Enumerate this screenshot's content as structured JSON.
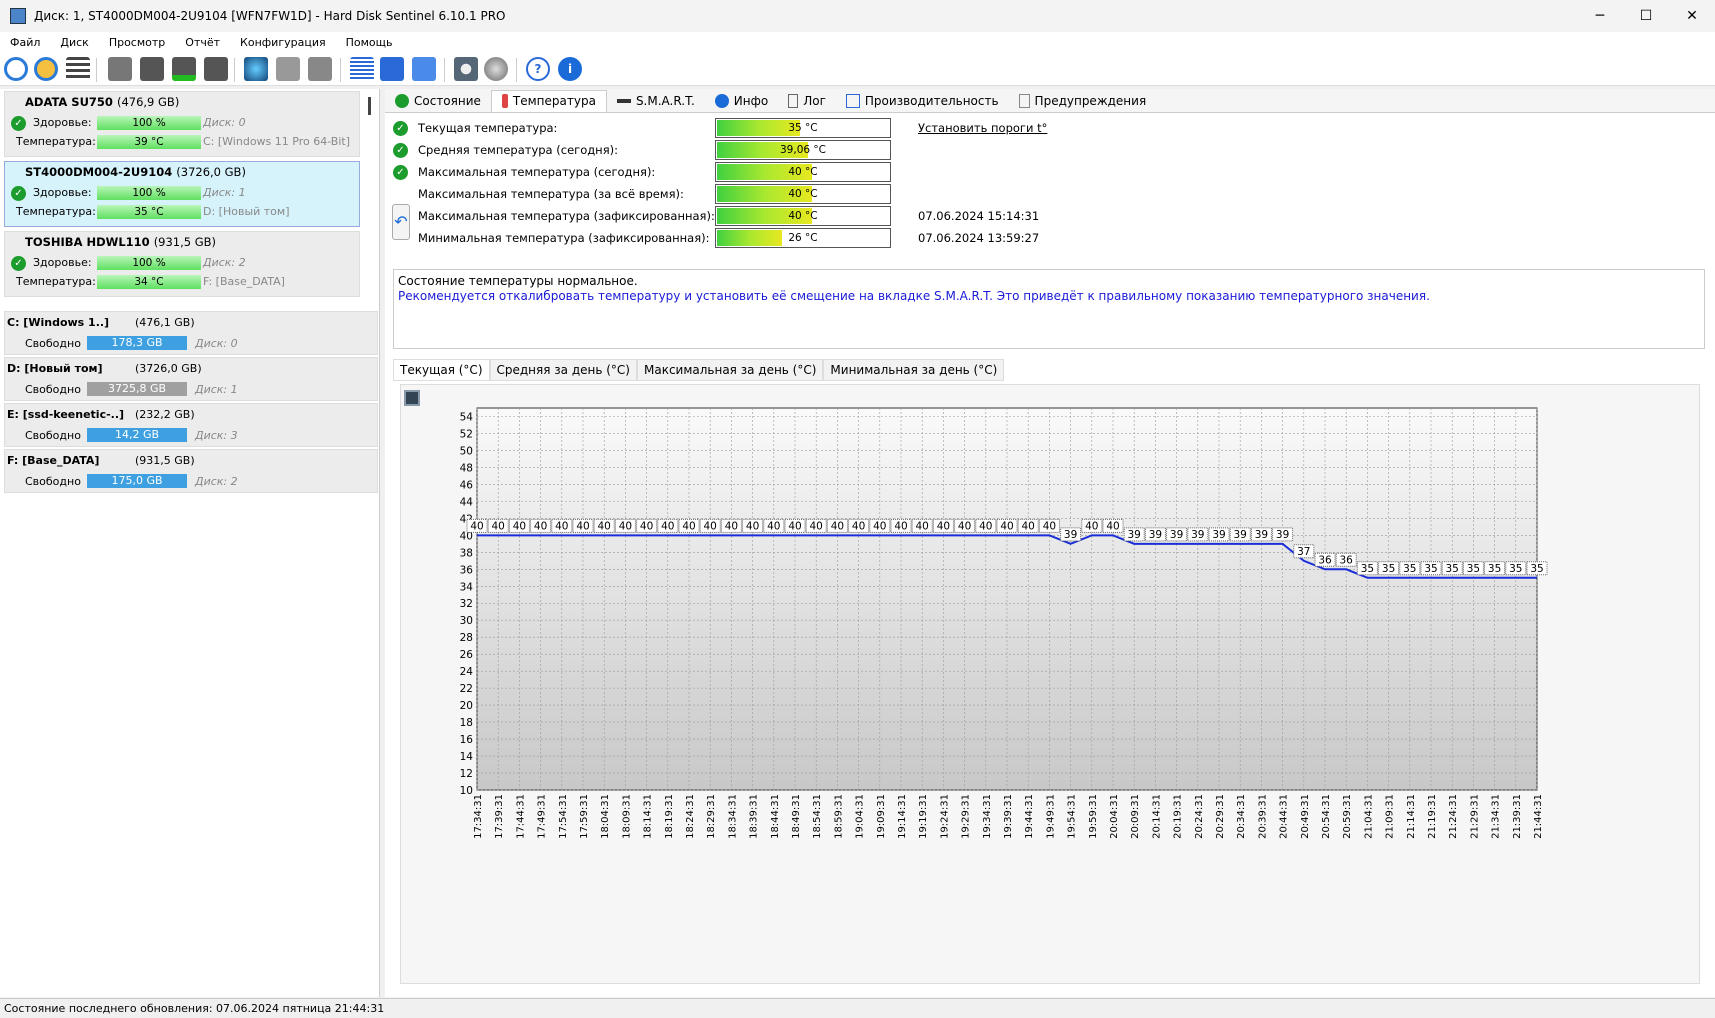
{
  "window": {
    "title": "Диск: 1, ST4000DM004-2U9104 [WFN7FW1D]  -  Hard Disk Sentinel 6.10.1 PRO",
    "min": "─",
    "max": "☐",
    "close": "✕"
  },
  "menu": [
    "Файл",
    "Диск",
    "Просмотр",
    "Отчёт",
    "Конфигурация",
    "Помощь"
  ],
  "disks": [
    {
      "name": "ADATA SU750",
      "size": "(476,9 GB)",
      "health_label": "Здоровье:",
      "health": "100 %",
      "health_value": 100,
      "disk": "Диск: 0",
      "temp_label": "Температура:",
      "temp": "39 °C",
      "vol": "C: [Windows 11 Pro 64-Bit]"
    },
    {
      "name": "ST4000DM004-2U9104",
      "size": "(3726,0 GB)",
      "health_label": "Здоровье:",
      "health": "100 %",
      "health_value": 100,
      "disk": "Диск: 1",
      "temp_label": "Температура:",
      "temp": "35 °C",
      "vol": "D: [Новый том]"
    },
    {
      "name": "TOSHIBA HDWL110",
      "size": "(931,5 GB)",
      "health_label": "Здоровье:",
      "health": "100 %",
      "health_value": 100,
      "disk": "Диск: 2",
      "temp_label": "Температура:",
      "temp": "34 °C",
      "vol": "F: [Base_DATA]"
    }
  ],
  "volumes": [
    {
      "name": "C: [Windows 1..]",
      "size": "(476,1 GB)",
      "free_label": "Свободно",
      "free": "178,3 GB",
      "disk": "Диск: 0",
      "color": "#3ea0e0"
    },
    {
      "name": "D: [Новый том]",
      "size": "(3726,0 GB)",
      "free_label": "Свободно",
      "free": "3725,8 GB",
      "disk": "Диск: 1",
      "color": "#a0a0a0"
    },
    {
      "name": "E: [ssd-keenetic-..]",
      "size": "(232,2 GB)",
      "free_label": "Свободно",
      "free": "14,2 GB",
      "disk": "Диск: 3",
      "color": "#3ea0e0"
    },
    {
      "name": "F: [Base_DATA]",
      "size": "(931,5 GB)",
      "free_label": "Свободно",
      "free": "175,0 GB",
      "disk": "Диск: 2",
      "color": "#3ea0e0"
    }
  ],
  "tabs": [
    "Состояние",
    "Температура",
    "S.M.A.R.T.",
    "Инфо",
    "Лог",
    "Производительность",
    "Предупреждения"
  ],
  "temps": [
    {
      "label": "Текущая температура:",
      "value": "35 °C",
      "pct": 48,
      "extra": "Установить пороги t°",
      "check": true
    },
    {
      "label": "Средняя температура (сегодня):",
      "value": "39,06 °C",
      "pct": 53,
      "extra": "",
      "check": true
    },
    {
      "label": "Максимальная температура (сегодня):",
      "value": "40 °C",
      "pct": 55,
      "extra": "",
      "check": true
    },
    {
      "label": "Максимальная температура (за всё время):",
      "value": "40 °C",
      "pct": 55,
      "extra": "",
      "check": false
    },
    {
      "label": "Максимальная температура (зафиксированная):",
      "value": "40 °C",
      "pct": 55,
      "extra": "07.06.2024 15:14:31",
      "check": false
    },
    {
      "label": "Минимальная температура (зафиксированная):",
      "value": "26 °C",
      "pct": 38,
      "extra": "07.06.2024 13:59:27",
      "check": false
    }
  ],
  "message": {
    "line1": "Состояние температуры нормальное.",
    "line2": "Рекомендуется откалибровать температуру и установить её смещение на вкладке S.M.A.R.T. Это приведёт к правильному показанию температурного значения."
  },
  "chart_tabs": [
    "Текущая (°C)",
    "Средняя за день (°C)",
    "Максимальная за день (°C)",
    "Минимальная за день (°C)"
  ],
  "chart_data": {
    "type": "line",
    "ylim": [
      10,
      55
    ],
    "yticks": [
      10,
      12,
      14,
      16,
      18,
      20,
      22,
      24,
      26,
      28,
      30,
      32,
      34,
      36,
      38,
      40,
      42,
      44,
      46,
      48,
      50,
      52,
      54
    ],
    "x": [
      "17:34:31",
      "17:39:31",
      "17:44:31",
      "17:49:31",
      "17:54:31",
      "17:59:31",
      "18:04:31",
      "18:09:31",
      "18:14:31",
      "18:19:31",
      "18:24:31",
      "18:29:31",
      "18:34:31",
      "18:39:31",
      "18:44:31",
      "18:49:31",
      "18:54:31",
      "18:59:31",
      "19:04:31",
      "19:09:31",
      "19:14:31",
      "19:19:31",
      "19:24:31",
      "19:29:31",
      "19:34:31",
      "19:39:31",
      "19:44:31",
      "19:49:31",
      "19:54:31",
      "19:59:31",
      "20:04:31",
      "20:09:31",
      "20:14:31",
      "20:19:31",
      "20:24:31",
      "20:29:31",
      "20:34:31",
      "20:39:31",
      "20:44:31",
      "20:49:31",
      "20:54:31",
      "20:59:31",
      "21:04:31",
      "21:09:31",
      "21:14:31",
      "21:19:31",
      "21:24:31",
      "21:29:31",
      "21:34:31",
      "21:39:31",
      "21:44:31"
    ],
    "values": [
      40,
      40,
      40,
      40,
      40,
      40,
      40,
      40,
      40,
      40,
      40,
      40,
      40,
      40,
      40,
      40,
      40,
      40,
      40,
      40,
      40,
      40,
      40,
      40,
      40,
      40,
      40,
      40,
      39,
      40,
      40,
      39,
      39,
      39,
      39,
      39,
      39,
      39,
      39,
      37,
      36,
      36,
      35,
      35,
      35,
      35,
      35,
      35,
      35,
      35,
      35
    ],
    "grid": true,
    "line_color": "#1a2ed8"
  },
  "status": "Состояние последнего обновления: 07.06.2024 пятница 21:44:31"
}
